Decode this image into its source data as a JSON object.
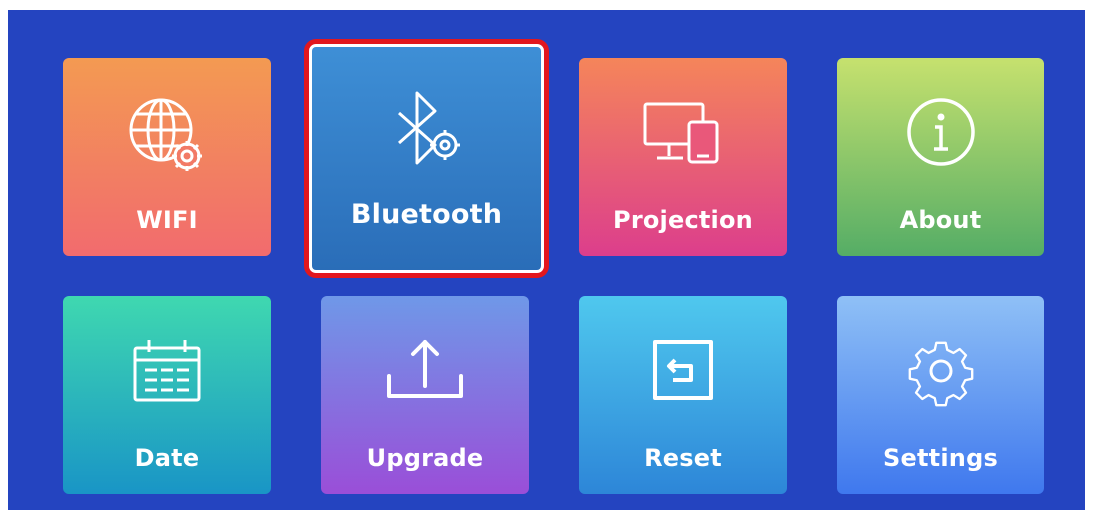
{
  "menu": {
    "tiles": [
      {
        "id": "wifi",
        "label": "WIFI",
        "icon": "globe-gear-icon"
      },
      {
        "id": "bluetooth",
        "label": "Bluetooth",
        "icon": "bluetooth-gear-icon",
        "selected": true
      },
      {
        "id": "projection",
        "label": "Projection",
        "icon": "monitor-phone-icon"
      },
      {
        "id": "about",
        "label": "About",
        "icon": "info-icon"
      },
      {
        "id": "date",
        "label": "Date",
        "icon": "calendar-icon"
      },
      {
        "id": "upgrade",
        "label": "Upgrade",
        "icon": "upload-icon"
      },
      {
        "id": "reset",
        "label": "Reset",
        "icon": "reset-icon"
      },
      {
        "id": "settings",
        "label": "Settings",
        "icon": "gear-icon"
      }
    ]
  },
  "colors": {
    "screen_bg": "#2444c0",
    "selection_border": "#e2171e"
  }
}
